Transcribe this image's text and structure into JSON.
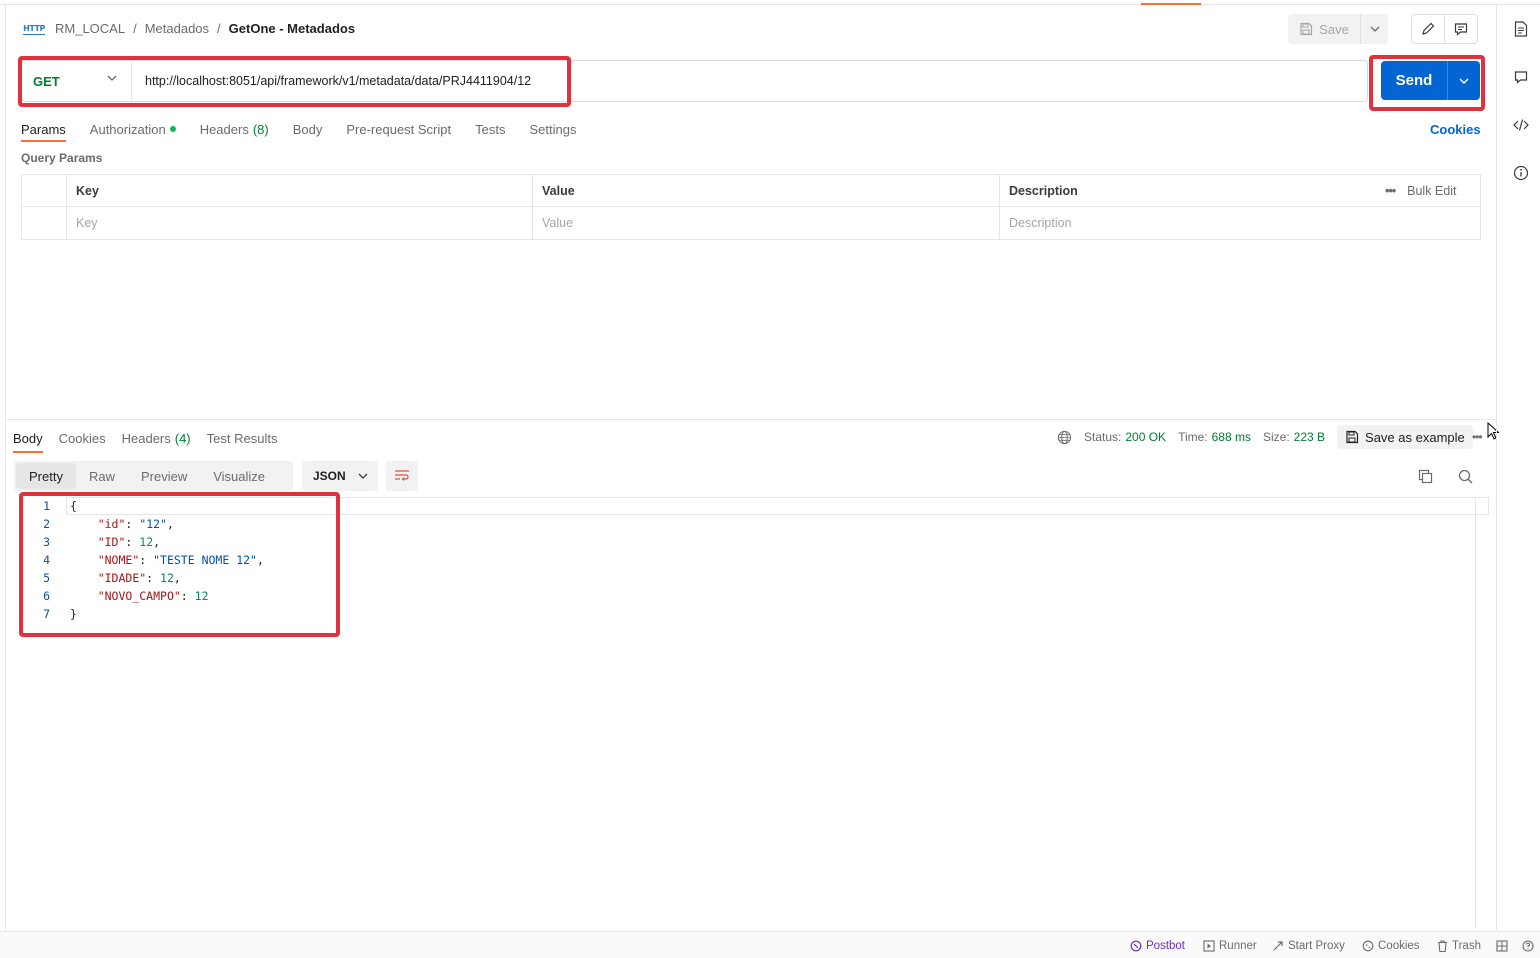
{
  "header": {
    "breadcrumb": [
      "RM_LOCAL",
      "Metadados",
      "GetOne - Metadados"
    ],
    "separator": "/",
    "http_icon_label": "HTTP",
    "save_label": "Save"
  },
  "request": {
    "method": "GET",
    "url": "http://localhost:8051/api/framework/v1/metadata/data/PRJ4411904/12",
    "send_label": "Send"
  },
  "request_tabs": [
    {
      "label": "Params",
      "active": true
    },
    {
      "label": "Authorization",
      "has_dot": true
    },
    {
      "label": "Headers",
      "count": "(8)"
    },
    {
      "label": "Body"
    },
    {
      "label": "Pre-request Script"
    },
    {
      "label": "Tests"
    },
    {
      "label": "Settings"
    }
  ],
  "cookies_label": "Cookies",
  "query_params": {
    "title": "Query Params",
    "headers": {
      "key": "Key",
      "value": "Value",
      "description": "Description"
    },
    "placeholders": {
      "key": "Key",
      "value": "Value",
      "description": "Description"
    },
    "bulk_edit": "Bulk Edit"
  },
  "response": {
    "tabs": [
      {
        "label": "Body",
        "active": true
      },
      {
        "label": "Cookies"
      },
      {
        "label": "Headers",
        "count": "(4)"
      },
      {
        "label": "Test Results"
      }
    ],
    "status_label": "Status:",
    "status_value": "200 OK",
    "time_label": "Time:",
    "time_value": "688 ms",
    "size_label": "Size:",
    "size_value": "223 B",
    "save_example": "Save as example",
    "view_tabs": [
      {
        "label": "Pretty",
        "active": true
      },
      {
        "label": "Raw"
      },
      {
        "label": "Preview"
      },
      {
        "label": "Visualize"
      }
    ],
    "format": "JSON",
    "code_lines": [
      {
        "num": "1",
        "text": "{"
      },
      {
        "num": "2",
        "key": "\"id\"",
        "value": "\"12\"",
        "type": "string",
        "comma": true
      },
      {
        "num": "3",
        "key": "\"ID\"",
        "value": "12",
        "type": "number",
        "comma": true
      },
      {
        "num": "4",
        "key": "\"NOME\"",
        "value": "\"TESTE NOME 12\"",
        "type": "string",
        "comma": true
      },
      {
        "num": "5",
        "key": "\"IDADE\"",
        "value": "12",
        "type": "number",
        "comma": true
      },
      {
        "num": "6",
        "key": "\"NOVO_CAMPO\"",
        "value": "12",
        "type": "number",
        "comma": false
      },
      {
        "num": "7",
        "text": "}"
      }
    ]
  },
  "status_bar": {
    "postbot": "Postbot",
    "runner": "Runner",
    "start_proxy": "Start Proxy",
    "cookies": "Cookies",
    "trash": "Trash"
  },
  "colors": {
    "accent": "#ff6c37",
    "send": "#0265d2",
    "method_get": "#007f31",
    "highlight": "#e0313f"
  }
}
